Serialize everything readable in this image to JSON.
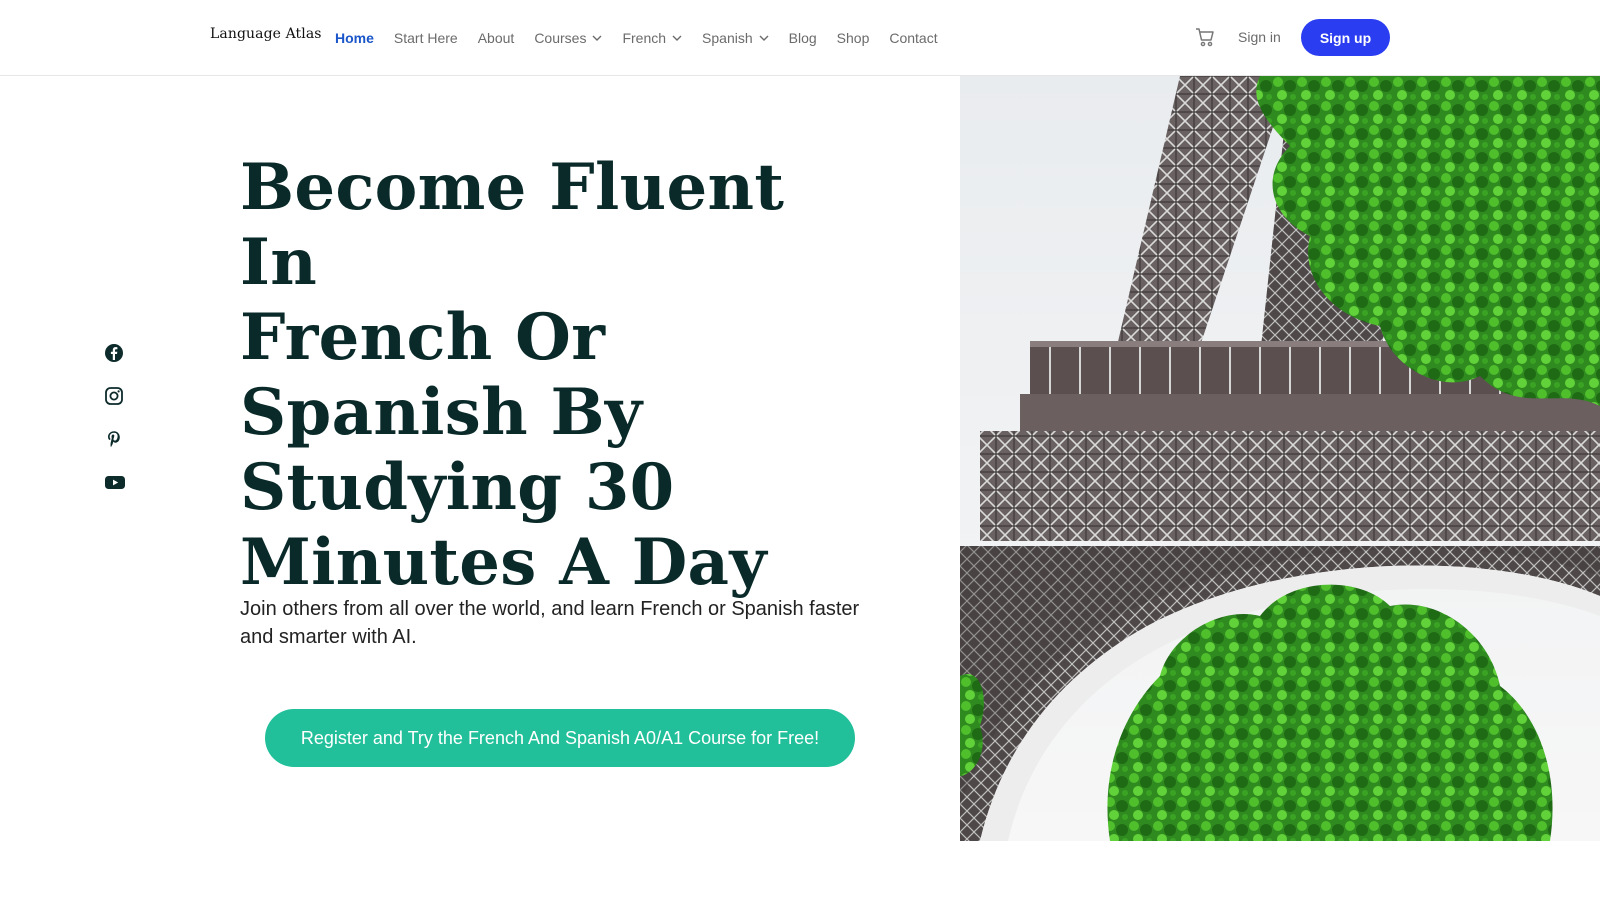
{
  "brand": {
    "name": "Language Atlas"
  },
  "nav": {
    "items": [
      {
        "label": "Home",
        "active": true,
        "dropdown": false
      },
      {
        "label": "Start Here",
        "active": false,
        "dropdown": false
      },
      {
        "label": "About",
        "active": false,
        "dropdown": false
      },
      {
        "label": "Courses",
        "active": false,
        "dropdown": true
      },
      {
        "label": "French",
        "active": false,
        "dropdown": true
      },
      {
        "label": "Spanish",
        "active": false,
        "dropdown": true
      },
      {
        "label": "Blog",
        "active": false,
        "dropdown": false
      },
      {
        "label": "Shop",
        "active": false,
        "dropdown": false
      },
      {
        "label": "Contact",
        "active": false,
        "dropdown": false
      }
    ]
  },
  "header_actions": {
    "cart_icon": "cart-icon",
    "signin_label": "Sign in",
    "signup_label": "Sign up"
  },
  "social": {
    "icons": [
      "facebook-icon",
      "instagram-icon",
      "pinterest-icon",
      "youtube-icon"
    ]
  },
  "hero": {
    "headline_lines": [
      "Become Fluent In",
      "French Or",
      "Spanish By",
      "Studying 30",
      "Minutes A Day"
    ],
    "subtitle": "Join others from all over the world, and learn French or Spanish faster and smarter with AI.",
    "cta_label": "Register and Try the French And Spanish A0/A1 Course for Free!"
  },
  "colors": {
    "accent_nav": "#1a56c9",
    "signup_button": "#2a3df0",
    "cta_button": "#22c09a",
    "headline": "#0a2a2a"
  }
}
